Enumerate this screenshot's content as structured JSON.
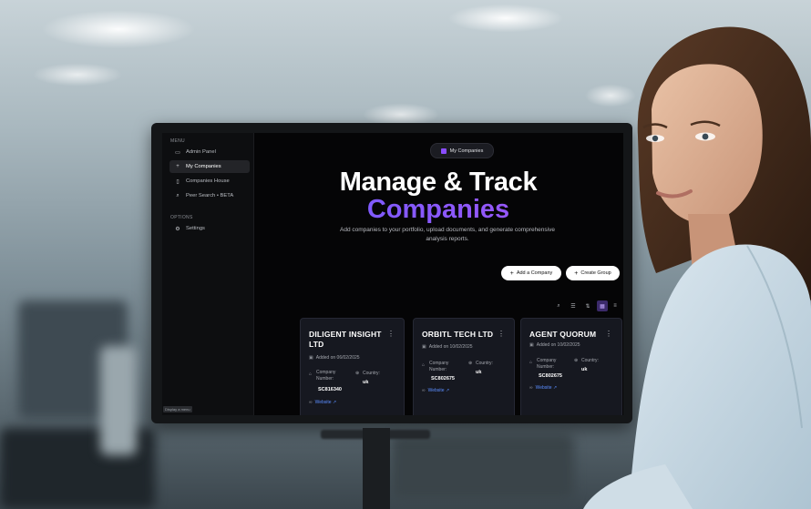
{
  "sidebar": {
    "menu_heading": "MENU",
    "items": [
      {
        "label": "Admin Panel",
        "icon": "monitor-icon"
      },
      {
        "label": "My Companies",
        "icon": "plus-icon",
        "active": true
      },
      {
        "label": "Companies House",
        "icon": "book-icon"
      },
      {
        "label": "Peer Search • BETA",
        "icon": "search-icon"
      }
    ],
    "options_heading": "OPTIONS",
    "settings_label": "Settings",
    "hint": "Display a menu"
  },
  "header": {
    "pill_label": "My Companies",
    "title_line1": "Manage & Track",
    "title_line2": "Companies",
    "subtitle": "Add companies to your portfolio, upload documents, and generate comprehensive analysis reports.",
    "add_company_label": "Add a Company",
    "create_group_label": "Create Group"
  },
  "cards": [
    {
      "name": "DILIGENT INSIGHT LTD",
      "added": "Added on 06/02/2025",
      "company_number_label": "Company Number:",
      "company_number": "SC816340",
      "country_label": "Country:",
      "country": "uk",
      "website": "Website ↗"
    },
    {
      "name": "ORBITL TECH LTD",
      "added": "Added on 10/02/2025",
      "company_number_label": "Company Number:",
      "company_number": "SC802675",
      "country_label": "Country:",
      "country": "uk",
      "website": "Website ↗"
    },
    {
      "name": "AGENT QUORUM",
      "added": "Added on 10/02/2025",
      "company_number_label": "Company Number:",
      "company_number": "SC802675",
      "country_label": "Country:",
      "country": "uk",
      "website": "Website ↗"
    }
  ],
  "colors": {
    "accent": "#8b5cf6",
    "screen_bg": "#050506",
    "card_bg": "#161820"
  }
}
